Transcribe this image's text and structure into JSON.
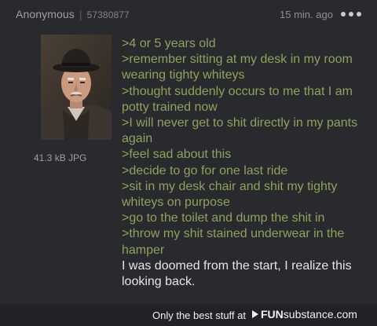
{
  "post": {
    "poster_name": "Anonymous",
    "separator": "|",
    "post_number": "57380877",
    "timestamp": "15 min. ago",
    "file_info": "41.3 kB JPG",
    "lines": [
      {
        "type": "quote",
        "text": ">4 or 5 years old"
      },
      {
        "type": "quote",
        "text": ">remember sitting at my desk in my room wearing tighty whiteys"
      },
      {
        "type": "quote",
        "text": ">thought suddenly occurs to me that I am potty trained now"
      },
      {
        "type": "quote",
        "text": ">I will never get to shit directly in my pants again"
      },
      {
        "type": "quote",
        "text": ">feel sad about this"
      },
      {
        "type": "quote",
        "text": ">decide to go for one last ride"
      },
      {
        "type": "quote",
        "text": ">sit in my desk chair and shit my tighty whiteys on purpose"
      },
      {
        "type": "quote",
        "text": ">go to the toilet and dump the shit in"
      },
      {
        "type": "quote",
        "text": ">throw my shit stained underwear in the hamper"
      },
      {
        "type": "plain",
        "text": "I was doomed from the start, I realize this looking back."
      }
    ]
  },
  "footer": {
    "tagline": "Only the best stuff at",
    "brand_fun": "FUN",
    "brand_substance": "substance",
    "brand_com": ".com"
  },
  "colors": {
    "background": "#282a2e",
    "greentext": "#8fa25e",
    "plain_text": "#e6e6e6"
  },
  "icons": [
    "more-options-icon",
    "funsubstance-logo-icon"
  ]
}
